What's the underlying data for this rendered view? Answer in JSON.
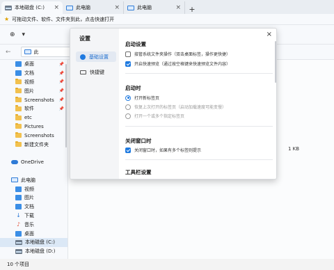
{
  "tabs": [
    {
      "label": "本地磁盘 (C:)",
      "active": true,
      "icon": "drive-icon"
    },
    {
      "label": "此电脑",
      "active": false,
      "icon": "computer-icon"
    },
    {
      "label": "此电脑",
      "active": false,
      "icon": "computer-icon"
    }
  ],
  "tab_close": "×",
  "tab_add": "+",
  "hint": "可拖动文件、软件、文件夹到此，点击快速打开",
  "address": {
    "partial": "此"
  },
  "sidebar": {
    "items": [
      {
        "label": "桌面",
        "icon": "desktop-icon",
        "pinned": true
      },
      {
        "label": "文档",
        "icon": "documents-icon",
        "pinned": true
      },
      {
        "label": "视频",
        "icon": "folder-icon",
        "pinned": true
      },
      {
        "label": "图片",
        "icon": "folder-icon",
        "pinned": true
      },
      {
        "label": "Screenshots",
        "icon": "folder-icon",
        "pinned": true
      },
      {
        "label": "软件",
        "icon": "folder-icon",
        "pinned": true
      },
      {
        "label": "etc",
        "icon": "folder-icon",
        "pinned": false
      },
      {
        "label": "Pictures",
        "icon": "folder-icon",
        "pinned": false
      },
      {
        "label": "Screenshots",
        "icon": "folder-icon",
        "pinned": false
      },
      {
        "label": "新建文件夹",
        "icon": "folder-icon",
        "pinned": false
      },
      {
        "label": "",
        "icon": "",
        "pinned": false
      },
      {
        "label": "OneDrive",
        "icon": "onedrive-icon",
        "pinned": false
      },
      {
        "label": "",
        "icon": "",
        "pinned": false
      },
      {
        "label": "此电脑",
        "icon": "computer-icon",
        "pinned": false
      },
      {
        "label": "视频",
        "icon": "videos-icon",
        "pinned": false
      },
      {
        "label": "图片",
        "icon": "pictures-icon",
        "pinned": false
      },
      {
        "label": "文档",
        "icon": "documents-icon",
        "pinned": false
      },
      {
        "label": "下载",
        "icon": "downloads-icon",
        "pinned": false
      },
      {
        "label": "音乐",
        "icon": "music-icon",
        "pinned": false
      },
      {
        "label": "桌面",
        "icon": "desktop-icon",
        "pinned": false
      },
      {
        "label": "本地磁盘 (C:)",
        "icon": "drive-icon",
        "pinned": false,
        "selected": true
      },
      {
        "label": "本地磁盘 (D:)",
        "icon": "drive-icon",
        "pinned": false
      }
    ]
  },
  "main": {
    "file_size": "1 KB"
  },
  "status": {
    "count": "10 个项目"
  },
  "dialog": {
    "title": "设置",
    "close": "×",
    "nav": [
      {
        "label": "基础设置",
        "selected": true
      },
      {
        "label": "快捷键",
        "selected": false
      }
    ],
    "sections": {
      "startup_settings": {
        "heading": "启动设置",
        "options": [
          {
            "label": "接管系统文件夹操作（双击桌面标签，操作更快捷）",
            "checked": false
          },
          {
            "label": "开启快速预览（通过按空格键来快速预览文件内容）",
            "checked": true
          }
        ]
      },
      "on_startup": {
        "heading": "启动时",
        "options": [
          {
            "label": "打开新标签页",
            "selected": true
          },
          {
            "label": "恢复上次打开的标签页（启动加载速度可能变慢）",
            "selected": false
          },
          {
            "label": "打开一个或多个指定标签页",
            "selected": false
          }
        ]
      },
      "close_window": {
        "heading": "关闭窗口时",
        "options": [
          {
            "label": "关闭窗口时，如果有多个标签则提示",
            "checked": true
          }
        ]
      },
      "toolbar_settings": {
        "heading": "工具栏设置"
      }
    },
    "accent_color": "#1f7ae0"
  }
}
